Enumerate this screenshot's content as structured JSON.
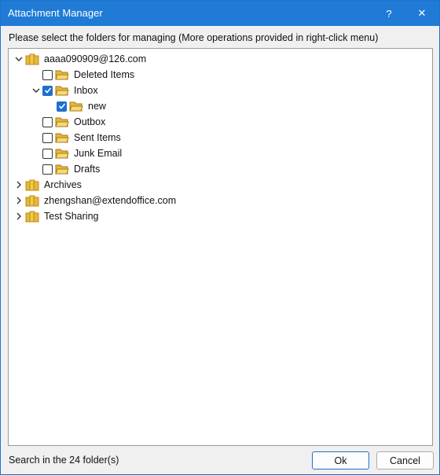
{
  "window": {
    "title": "Attachment Manager",
    "help_label": "?",
    "close_label": "✕"
  },
  "instruction": "Please select the folders for managing (More operations provided in right-click menu)",
  "tree": {
    "account1": {
      "label": "aaaa090909@126.com",
      "expanded": true,
      "children": [
        {
          "label": "Deleted Items",
          "checked": false
        },
        {
          "label": "Inbox",
          "checked": true,
          "expanded": true,
          "children": [
            {
              "label": "new",
              "checked": true
            }
          ]
        },
        {
          "label": "Outbox",
          "checked": false
        },
        {
          "label": "Sent Items",
          "checked": false
        },
        {
          "label": "Junk Email",
          "checked": false
        },
        {
          "label": "Drafts",
          "checked": false
        }
      ]
    },
    "archives": {
      "label": "Archives",
      "expanded": false
    },
    "account2": {
      "label": "zhengshan@extendoffice.com",
      "expanded": false
    },
    "test_sharing": {
      "label": "Test Sharing",
      "expanded": false
    }
  },
  "status": "Search in the 24 folder(s)",
  "buttons": {
    "ok": "Ok",
    "cancel": "Cancel"
  },
  "colors": {
    "titlebar": "#1f7bd6",
    "checkbox_checked": "#1e6fd0",
    "folder": "#f2c94c",
    "mailbox": "#e7b73a"
  },
  "icons": {
    "mailbox": "mailbox-stack-icon",
    "folder": "open-folder-icon",
    "collapse": "chevron-down-icon",
    "expand": "chevron-right-icon",
    "check": "checkmark-icon"
  }
}
